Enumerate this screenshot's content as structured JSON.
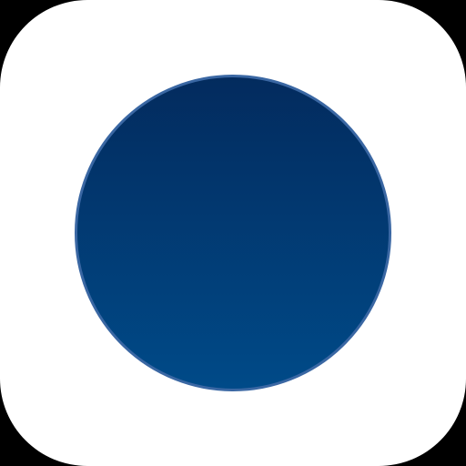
{
  "icon": {
    "name": "app-icon",
    "tile_color": "#ffffff",
    "background_color": "#000000",
    "disc": {
      "name": "circle-icon",
      "gradient_top": "#032b5e",
      "gradient_bottom": "#004a88",
      "border_color": "#3a67a3"
    }
  }
}
